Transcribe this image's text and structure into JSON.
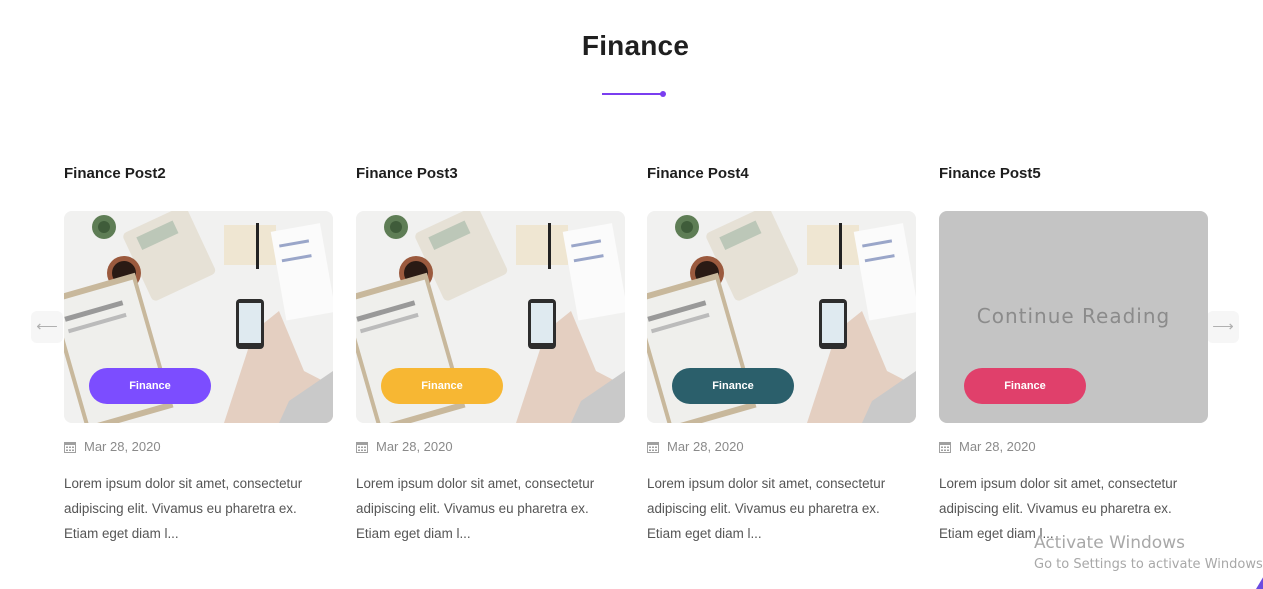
{
  "section": {
    "title": "Finance"
  },
  "colors": {
    "accent": "#7a3ef0",
    "purple": "#7c4dff",
    "yellow": "#f7b733",
    "teal": "#2b5f6b",
    "pink": "#e0406b"
  },
  "nav": {
    "prev_icon": "arrow-left-icon",
    "next_icon": "arrow-right-icon",
    "prev": "⟵",
    "next": "⟶"
  },
  "posts": [
    {
      "title": "Finance Post2",
      "category": "Finance",
      "date": "Mar 28, 2020",
      "excerpt": "Lorem ipsum dolor sit amet, consectetur adipiscing elit. Vivamus eu pharetra ex. Etiam eget diam l..."
    },
    {
      "title": "Finance Post3",
      "category": "Finance",
      "date": "Mar 28, 2020",
      "excerpt": "Lorem ipsum dolor sit amet, consectetur adipiscing elit. Vivamus eu pharetra ex. Etiam eget diam l..."
    },
    {
      "title": "Finance Post4",
      "category": "Finance",
      "date": "Mar 28, 2020",
      "excerpt": "Lorem ipsum dolor sit amet, consectetur adipiscing elit. Vivamus eu pharetra ex. Etiam eget diam l..."
    },
    {
      "title": "Finance Post5",
      "category": "Finance",
      "date": "Mar 28, 2020",
      "excerpt": "Lorem ipsum dolor sit amet, consectetur adipiscing elit. Vivamus eu pharetra ex. Etiam eget diam l...",
      "overlay_text": "Continue Reading"
    }
  ],
  "watermark": {
    "line1": "Activate Windows",
    "line2": "Go to Settings to activate Windows."
  }
}
